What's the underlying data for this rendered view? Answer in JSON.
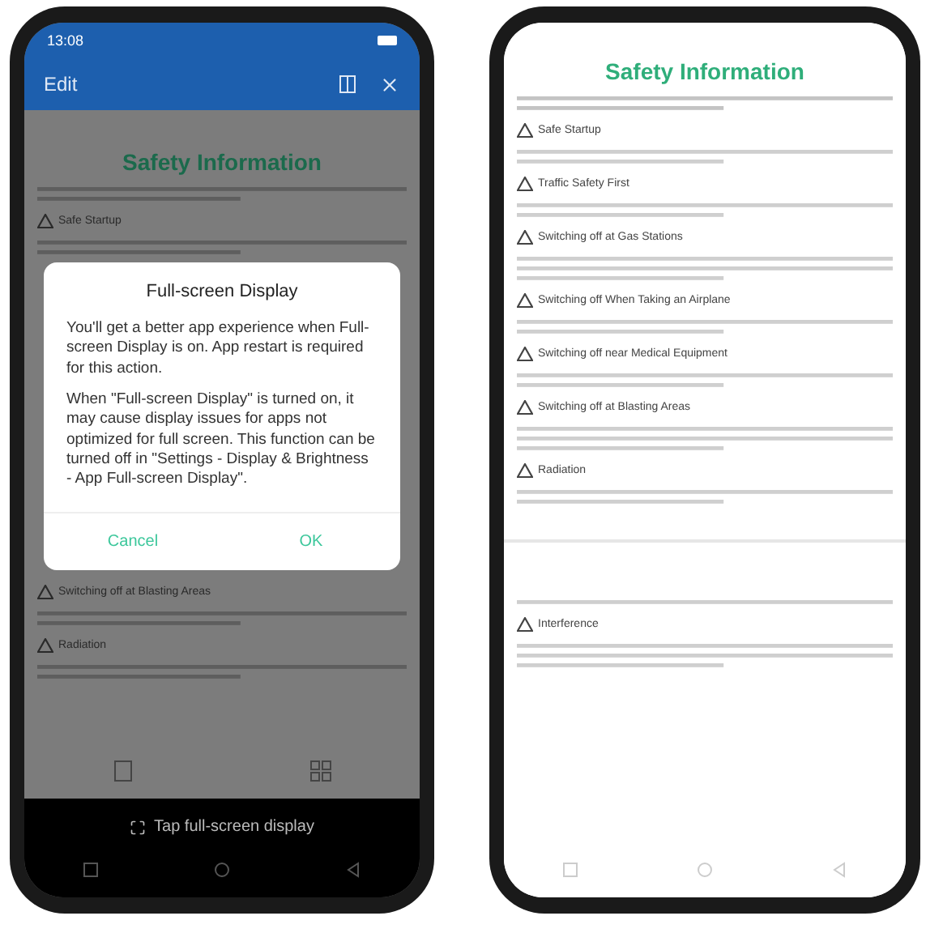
{
  "left_phone": {
    "status_time": "13:08",
    "app_bar": {
      "title": "Edit"
    },
    "page": {
      "title": "Safety Information",
      "sections_above": [
        "Safe Startup"
      ],
      "sections_below": [
        "Switching off at Blasting Areas",
        "Radiation"
      ]
    },
    "dialog": {
      "title": "Full-screen Display",
      "paragraphs": [
        "You'll get a better app experience when Full-screen Display is on. App restart is required for this action.",
        "When \"Full-screen Display\" is turned on, it may cause display issues for apps not optimized for full screen. This function can be turned off in \"Settings - Display & Brightness - App Full-screen Display\"."
      ],
      "buttons": [
        "Cancel",
        "OK"
      ]
    },
    "hint": "Tap full-screen display"
  },
  "right_phone": {
    "page": {
      "title": "Safety Information",
      "sections": [
        "Safe Startup",
        "Traffic Safety First",
        "Switching off at Gas Stations",
        "Switching off When Taking an Airplane",
        "Switching off near Medical Equipment",
        "Switching off at Blasting Areas",
        "Radiation"
      ],
      "sections_after_break": [
        "Interference"
      ]
    }
  }
}
